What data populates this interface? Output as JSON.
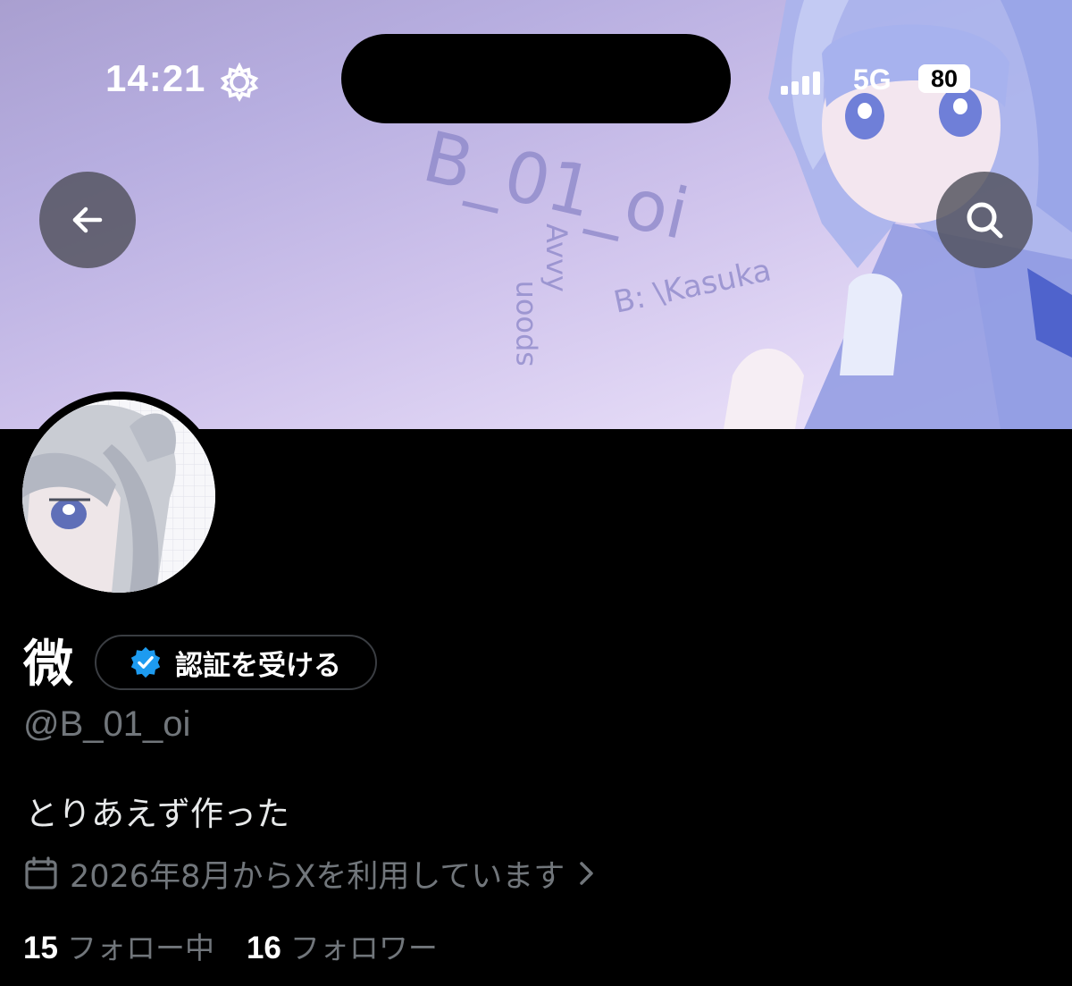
{
  "status_bar": {
    "time": "14:21",
    "network": "5G",
    "battery": "80"
  },
  "banner": {
    "text_title": "B_01_oi",
    "text_credit": "B: \\Kasuka",
    "text_sub_1": "Avvy",
    "text_sub_2": "spoon"
  },
  "profile": {
    "display_name": "微",
    "verify_button_label": "認証を受ける",
    "handle": "@B_01_oi",
    "bio": "とりあえず作った",
    "joined": "2026年8月からXを利用しています"
  },
  "stats": {
    "following_count": "15",
    "following_label": "フォロー中",
    "followers_count": "16",
    "followers_label": "フォロワー"
  },
  "colors": {
    "background": "#000000",
    "verify_badge": "#1d9bf0",
    "secondary_text": "#71767b",
    "banner_accent": "#7b86d6"
  }
}
